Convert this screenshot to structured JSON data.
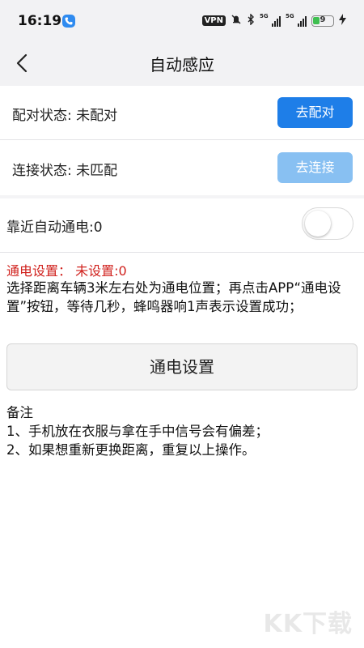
{
  "status_bar": {
    "time": "16:19",
    "vpn": "VPN",
    "signal1": "5G",
    "signal2": "5G",
    "battery": "9"
  },
  "nav": {
    "title": "自动感应"
  },
  "pair": {
    "label": "配对状态: 未配对",
    "button": "去配对",
    "button_color": "#1e7ee8"
  },
  "connect": {
    "label": "连接状态: 未匹配",
    "button": "去连接",
    "button_color": "#88c0f2"
  },
  "auto_power": {
    "label": "靠近自动通电:0",
    "toggle_on": false
  },
  "power_settings": {
    "status": "通电设置：  未设置:0",
    "instructions": "选择距离车辆3米左右处为通电位置；再点击APP“通电设置”按钮，等待几秒，蜂鸣器响1声表示设置成功；",
    "button": "通电设置"
  },
  "notes": {
    "title": "备注",
    "items": [
      "1、手机放在衣服与拿在手中信号会有偏差；",
      "2、如果想重新更换距离，重复以上操作。"
    ]
  },
  "watermark": "KK下载"
}
